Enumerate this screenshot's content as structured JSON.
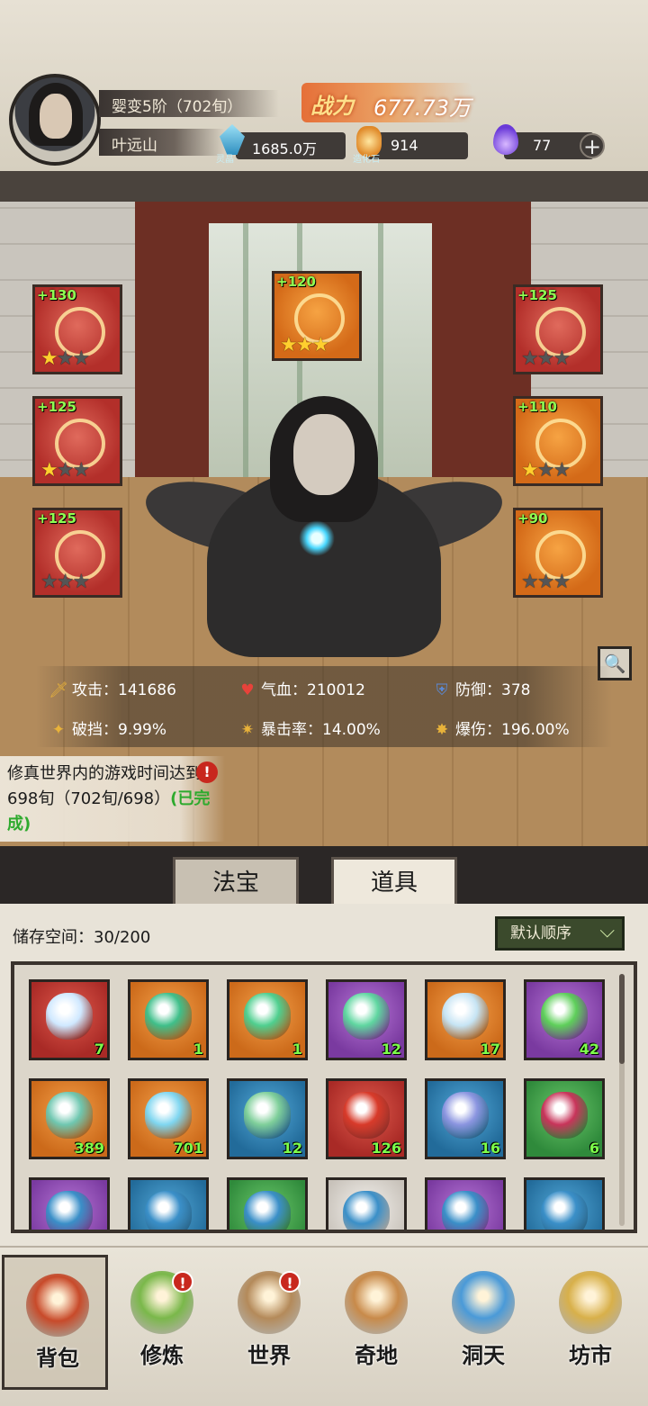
{
  "player": {
    "realm": "婴变5阶（702旬）",
    "name": "叶远山",
    "power_label": "战力",
    "power_value": "677.73万"
  },
  "resources": [
    {
      "id": "lingjing",
      "value": "1685.0万",
      "sub": "灵晶",
      "color": "#4fb6d8",
      "icon": "blue-crystal-icon"
    },
    {
      "id": "zaohuashi",
      "value": "914",
      "sub": "造化石",
      "color": "#e8a63c",
      "icon": "orange-stone-icon"
    },
    {
      "id": "flame",
      "value": "77",
      "sub": "",
      "color": "#7a4de8",
      "icon": "purple-flame-icon"
    }
  ],
  "plus_symbol": "+",
  "equipment": [
    {
      "slot": "weapon",
      "level": "+130",
      "stars": 1,
      "color": "red",
      "icon": "sword-icon"
    },
    {
      "slot": "talisman",
      "level": "+120",
      "stars": 3,
      "color": "orange",
      "icon": "golden-cloud-icon"
    },
    {
      "slot": "headband",
      "level": "+125",
      "stars": 0,
      "color": "red",
      "icon": "crown-icon"
    },
    {
      "slot": "robe",
      "level": "+125",
      "stars": 1,
      "color": "red",
      "icon": "robe-icon"
    },
    {
      "slot": "necklace",
      "level": "+110",
      "stars": 1,
      "color": "orange",
      "icon": "necklace-icon"
    },
    {
      "slot": "boots",
      "level": "+125",
      "stars": 0,
      "color": "red",
      "icon": "boots-icon"
    },
    {
      "slot": "ring",
      "level": "+90",
      "stars": 0,
      "color": "orange",
      "icon": "ring-icon"
    }
  ],
  "star_glyph": "★",
  "stats": [
    {
      "label": "攻击：141686",
      "icon": "sword-icon",
      "glyph": "🗡"
    },
    {
      "label": "气血：210012",
      "icon": "heart-icon",
      "glyph": "♥"
    },
    {
      "label": "防御：378",
      "icon": "shield-icon",
      "glyph": "⛨"
    },
    {
      "label": "破挡：9.99%",
      "icon": "shield-break-icon",
      "glyph": "✦"
    },
    {
      "label": "暴击率：14.00%",
      "icon": "crit-rate-icon",
      "glyph": "✷"
    },
    {
      "label": "爆伤：196.00%",
      "icon": "crit-damage-icon",
      "glyph": "✸"
    }
  ],
  "quest": {
    "text": "修真世界内的游戏时间达到698旬（702旬/698）",
    "status": "(已完成)",
    "badge": "!"
  },
  "tabs": {
    "fabao": "法宝",
    "daoju": "道具"
  },
  "inventory": {
    "storage": "储存空间：30/200",
    "sort": "默认顺序",
    "sort_chevron": "⌵",
    "items": [
      {
        "bg": "red",
        "count": "7",
        "icon": "crystal-orb-icon",
        "art": "#cfe8ff"
      },
      {
        "bg": "orange",
        "count": "1",
        "icon": "green-swirl-icon",
        "art": "#3fbf8a"
      },
      {
        "bg": "orange",
        "count": "1",
        "icon": "jade-gourd-icon",
        "art": "#4fcf8f"
      },
      {
        "bg": "purple",
        "count": "12",
        "icon": "green-crystal-icon",
        "art": "#5fd6a0"
      },
      {
        "bg": "orange",
        "count": "17",
        "icon": "ice-crystal-icon",
        "art": "#c6e4f4"
      },
      {
        "bg": "purple",
        "count": "42",
        "icon": "lightning-orb-icon",
        "art": "#5ecf5a"
      },
      {
        "bg": "orange",
        "count": "389",
        "icon": "wind-swirl-icon",
        "art": "#6fc7b0"
      },
      {
        "bg": "orange",
        "count": "701",
        "icon": "blue-shards-icon",
        "art": "#7fd6f0"
      },
      {
        "bg": "blue",
        "count": "12",
        "icon": "jade-cloud-icon",
        "art": "#7fcf9a"
      },
      {
        "bg": "red",
        "count": "126",
        "icon": "red-talisman-icon",
        "art": "#d83a2a"
      },
      {
        "bg": "blue",
        "count": "16",
        "icon": "blue-token-icon",
        "art": "#8b95e0"
      },
      {
        "bg": "green",
        "count": "6",
        "icon": "red-chest-icon",
        "art": "#c8345a"
      },
      {
        "bg": "purple",
        "count": "",
        "icon": "treasure-chest-icon",
        "art": "#3a8fc8"
      },
      {
        "bg": "blue",
        "count": "",
        "icon": "treasure-chest-icon",
        "art": "#3a8fc8"
      },
      {
        "bg": "green",
        "count": "",
        "icon": "treasure-chest-icon",
        "art": "#3a8fc8"
      },
      {
        "bg": "white",
        "count": "",
        "icon": "treasure-chest-icon",
        "art": "#3a8fc8"
      },
      {
        "bg": "purple",
        "count": "",
        "icon": "treasure-chest-icon",
        "art": "#3a8fc8"
      },
      {
        "bg": "blue",
        "count": "",
        "icon": "treasure-chest-icon",
        "art": "#3a8fc8"
      }
    ]
  },
  "nav": [
    {
      "id": "bag",
      "label": "背包",
      "badge": "",
      "icon": "bag-icon",
      "color": "#c84a2a"
    },
    {
      "id": "cultivate",
      "label": "修炼",
      "badge": "!",
      "icon": "lotus-icon",
      "color": "#7ab84a"
    },
    {
      "id": "world",
      "label": "世界",
      "badge": "!",
      "icon": "scroll-map-icon",
      "color": "#b48a5a"
    },
    {
      "id": "land",
      "label": "奇地",
      "badge": "",
      "icon": "pagoda-icon",
      "color": "#c88a4a"
    },
    {
      "id": "cave",
      "label": "洞天",
      "badge": "",
      "icon": "portal-icon",
      "color": "#4a9ad8"
    },
    {
      "id": "market",
      "label": "坊市",
      "badge": "",
      "icon": "market-stall-icon",
      "color": "#d8b04a"
    }
  ],
  "zoom_glyph": "🔍"
}
